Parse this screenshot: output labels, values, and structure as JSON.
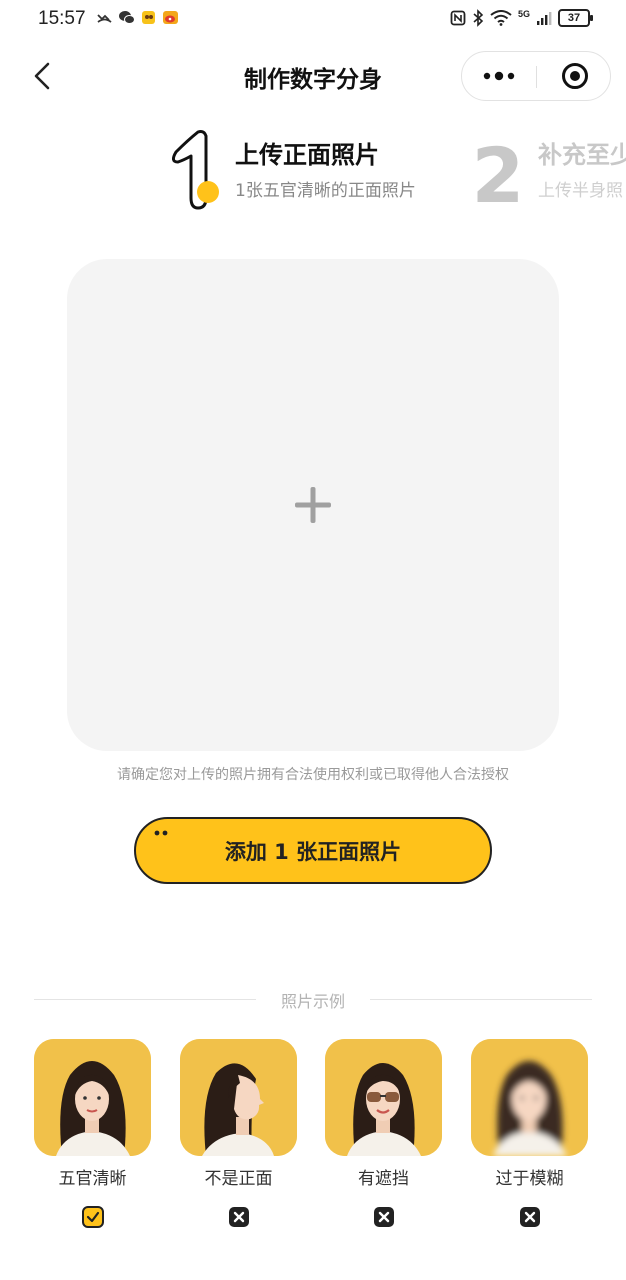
{
  "status_bar": {
    "time": "15:57",
    "battery": "37",
    "network": "5G"
  },
  "nav": {
    "title": "制作数字分身"
  },
  "steps": [
    {
      "number": "1",
      "title": "上传正面照片",
      "description": "1张五官清晰的正面照片",
      "active": true
    },
    {
      "number": "2",
      "title": "补充至少",
      "description": "上传半身照",
      "active": false
    }
  ],
  "upload": {
    "notice": "请确定您对上传的照片拥有合法使用权利或已取得他人合法授权"
  },
  "add_button": {
    "label": "添加 1 张正面照片"
  },
  "examples_section": {
    "title": "照片示例",
    "items": [
      {
        "label": "五官清晰",
        "status": "correct"
      },
      {
        "label": "不是正面",
        "status": "wrong"
      },
      {
        "label": "有遮挡",
        "status": "wrong"
      },
      {
        "label": "过于模糊",
        "status": "wrong"
      }
    ]
  },
  "colors": {
    "accent": "#ffc21a",
    "photo_background": "#f1c14a"
  }
}
